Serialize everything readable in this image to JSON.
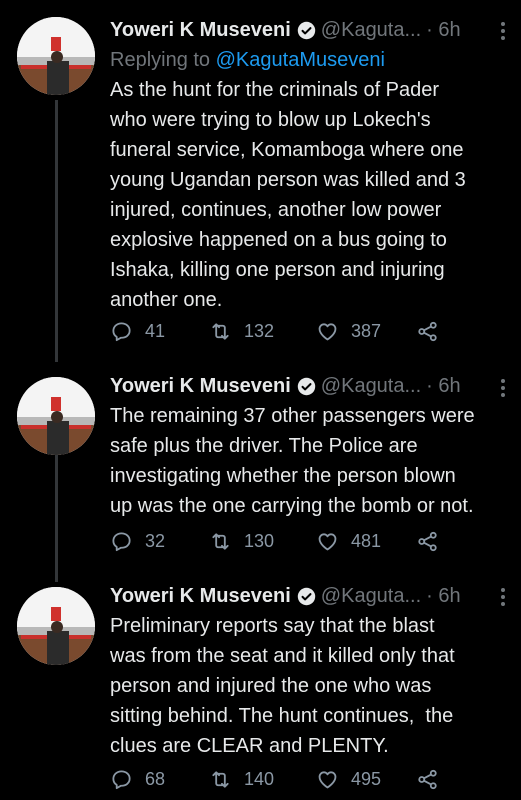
{
  "tweets": [
    {
      "author": "Yoweri K Museveni",
      "handle": "@Kaguta...",
      "time": "· 6h",
      "replying_prefix": "Replying to ",
      "replying_handle": "@KagutaMuseveni",
      "text": "As the hunt for the criminals of Pader\nwho were trying to blow up Lokech's\nfuneral service, Komamboga where one\nyoung Ugandan person was killed and 3\ninjured, continues, another low power\nexplosive happened on a bus going to\nIshaka, killing one person and injuring\nanother one.",
      "replies": "41",
      "retweets": "132",
      "likes": "387"
    },
    {
      "author": "Yoweri K Museveni",
      "handle": "@Kaguta...",
      "time": "· 6h",
      "text": "The remaining 37 other passengers were\nsafe plus the driver. The Police are\ninvestigating whether the person blown\nup was the one carrying the bomb or not.",
      "replies": "32",
      "retweets": "130",
      "likes": "481"
    },
    {
      "author": "Yoweri K Museveni",
      "handle": "@Kaguta...",
      "time": "· 6h",
      "text": "Preliminary reports say that the blast\nwas from the seat and it killed only that\nperson and injured the one who was\nsitting behind. The hunt continues,  the\nclues are CLEAR and PLENTY.",
      "replies": "68",
      "retweets": "140",
      "likes": "495"
    }
  ],
  "icons": {
    "verified": "verified-badge-icon",
    "reply": "reply-icon",
    "retweet": "retweet-icon",
    "like": "heart-icon",
    "share": "share-icon",
    "more": "more-vertical-icon"
  },
  "colors": {
    "background": "#000000",
    "text": "#e7e9ea",
    "secondary": "#71767b",
    "link": "#1d9bf0"
  }
}
